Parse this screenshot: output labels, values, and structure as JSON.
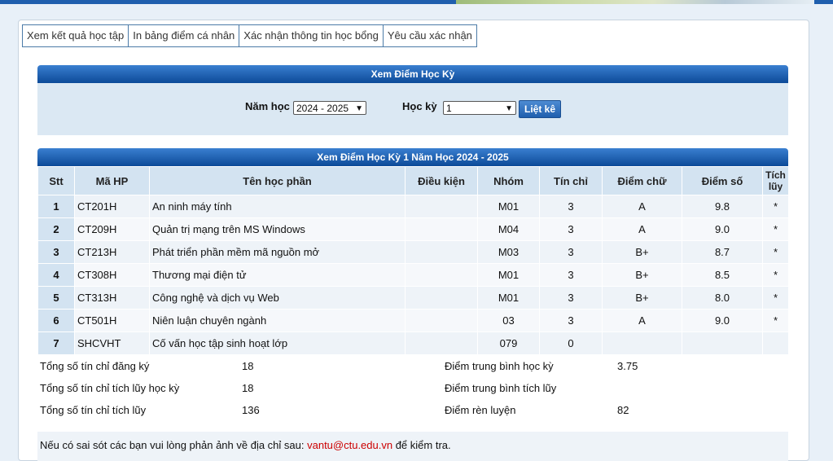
{
  "tabs": [
    "Xem kết quả học tập",
    "In bảng điểm cá nhân",
    "Xác nhận thông tin học bổng",
    "Yêu cầu xác nhận"
  ],
  "filter": {
    "title": "Xem Điểm Học Kỳ",
    "year_label": "Năm học",
    "year_value": "2024 - 2025",
    "semester_label": "Học kỳ",
    "semester_value": "1",
    "list_button": "Liệt kê"
  },
  "grades": {
    "title": "Xem Điểm Học Kỳ 1 Năm Học 2024 - 2025",
    "columns": [
      "Stt",
      "Mã HP",
      "Tên học phần",
      "Điều kiện",
      "Nhóm",
      "Tín chỉ",
      "Điểm chữ",
      "Điểm số",
      "Tích lũy"
    ],
    "rows": [
      [
        "1",
        "CT201H",
        "An ninh máy tính",
        "",
        "M01",
        "3",
        "A",
        "9.8",
        "*"
      ],
      [
        "2",
        "CT209H",
        "Quản trị mạng trên MS Windows",
        "",
        "M04",
        "3",
        "A",
        "9.0",
        "*"
      ],
      [
        "3",
        "CT213H",
        "Phát triển phần mềm mã nguồn mở",
        "",
        "M03",
        "3",
        "B+",
        "8.7",
        "*"
      ],
      [
        "4",
        "CT308H",
        "Thương mại điện tử",
        "",
        "M01",
        "3",
        "B+",
        "8.5",
        "*"
      ],
      [
        "5",
        "CT313H",
        "Công nghệ và dịch vụ Web",
        "",
        "M01",
        "3",
        "B+",
        "8.0",
        "*"
      ],
      [
        "6",
        "CT501H",
        "Niên luận chuyên ngành",
        "",
        "03",
        "3",
        "A",
        "9.0",
        "*"
      ],
      [
        "7",
        "SHCVHT",
        "Cố vấn học tập sinh hoạt lớp",
        "",
        "079",
        "0",
        "",
        "",
        ""
      ]
    ]
  },
  "summary": {
    "registered_label": "Tổng số tín chỉ đăng ký",
    "registered_value": "18",
    "sem_accum_label": "Tổng số tín chỉ tích lũy học kỳ",
    "sem_accum_value": "18",
    "total_accum_label": "Tổng số tín chỉ tích lũy",
    "total_accum_value": "136",
    "gpa_sem_label": "Điểm trung bình học kỳ",
    "gpa_sem_value": "3.75",
    "gpa_accum_label": "Điểm trung bình tích lũy",
    "gpa_accum_value": "",
    "conduct_label": "Điểm rèn luyện",
    "conduct_value": "82"
  },
  "note": {
    "prefix": "Nếu có sai sót các bạn vui lòng phản ảnh về địa chỉ sau: ",
    "email": "vantu@ctu.edu.vn",
    "suffix": " để kiểm tra."
  }
}
